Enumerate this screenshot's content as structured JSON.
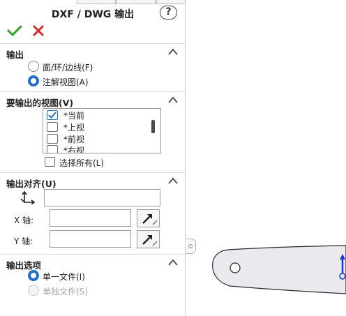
{
  "panel": {
    "title": "DXF / DWG 输出",
    "help_glyph": "?",
    "accent_color": "#1f6fc6"
  },
  "sections": {
    "output": {
      "label": "输出",
      "options": [
        {
          "label": "面/环/边线(F)",
          "selected": false
        },
        {
          "label": "注解视图(A)",
          "selected": true
        }
      ]
    },
    "views": {
      "label": "要输出的视图(V)",
      "items": [
        {
          "label": "*当前",
          "checked": true
        },
        {
          "label": "*上视",
          "checked": false
        },
        {
          "label": "*前视",
          "checked": false
        },
        {
          "label": "*右视",
          "checked": false
        }
      ],
      "select_all_label": "选择所有(L)"
    },
    "align": {
      "label": "输出对齐(U)",
      "origin_value": "",
      "x_label": "X 轴:",
      "x_value": "",
      "y_label": "Y 轴:",
      "y_value": ""
    },
    "options": {
      "label": "输出选项",
      "choices": [
        {
          "label": "单一文件(I)",
          "selected": true,
          "enabled": true
        },
        {
          "label": "单独文件(S)",
          "selected": false,
          "enabled": false
        }
      ]
    }
  }
}
